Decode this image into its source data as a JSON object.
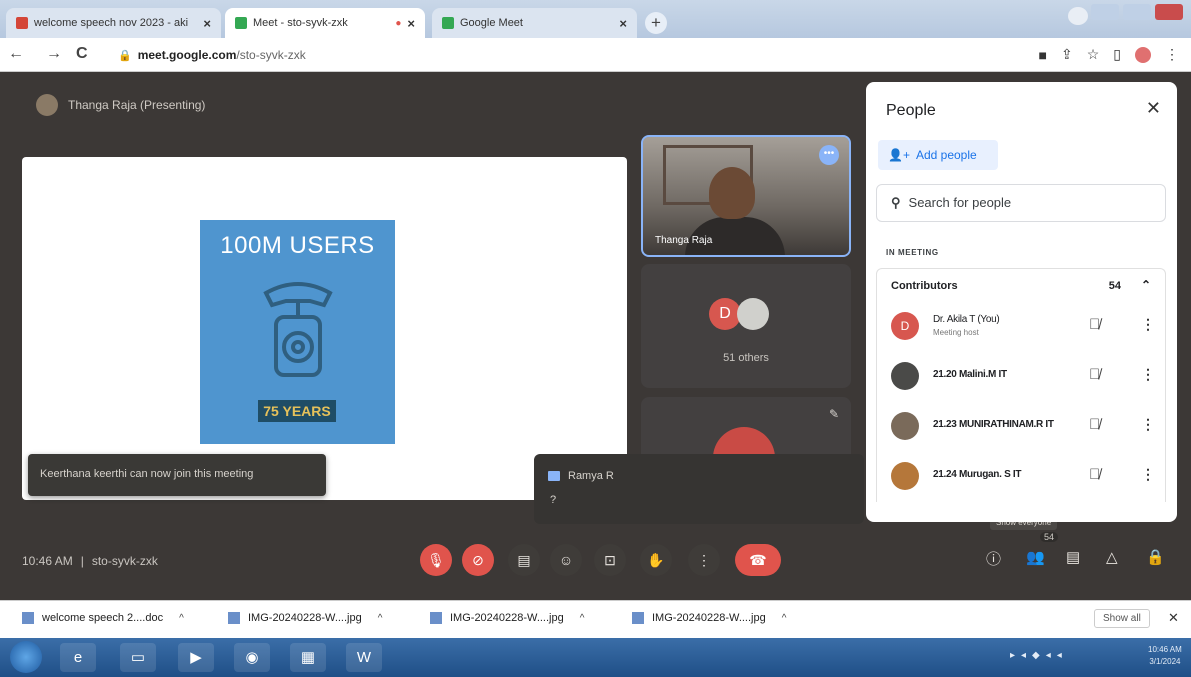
{
  "browser": {
    "tabs": [
      {
        "title": "welcome speech nov 2023 - aki",
        "icon": "gmail-icon",
        "active": false
      },
      {
        "title": "Meet - sto-syvk-zxk",
        "icon": "meet-icon",
        "active": true
      },
      {
        "title": "Google Meet",
        "icon": "meet-icon",
        "active": false
      }
    ],
    "url_host": "meet.google.com",
    "url_path": "/sto-syvk-zxk"
  },
  "meet": {
    "presenter": "Thanga Raja (Presenting)",
    "slide": {
      "title": "100M USERS",
      "badge": "75 YEARS"
    },
    "toast": "Keerthana keerthi can now join this meeting",
    "tiles": {
      "speaker_name": "Thanga Raja",
      "group_avatar_letter": "D",
      "others": "51 others"
    },
    "chat_popup": {
      "sender": "Ramya R",
      "message": "?"
    },
    "time": "10:46 AM",
    "meeting_code": "sto-syvk-zxk",
    "tooltip": "Show everyone",
    "people_count_badge": "54"
  },
  "people_panel": {
    "title": "People",
    "add_people": "Add people",
    "search_placeholder": "Search for people",
    "section": "IN MEETING",
    "contributors_label": "Contributors",
    "contributors_count": "54",
    "participants": [
      {
        "name": "Dr. Akila T (You)",
        "sub": "Meeting host",
        "avatar_color": "#d7574f",
        "initial": "D"
      },
      {
        "name": "21.20 Malini.M IT",
        "sub": "",
        "avatar_color": "#4a4a48",
        "initial": ""
      },
      {
        "name": "21.23 MUNIRATHINAM.R IT",
        "sub": "",
        "avatar_color": "#7a6a5a",
        "initial": ""
      },
      {
        "name": "21.24 Murugan. S IT",
        "sub": "",
        "avatar_color": "#b5773a",
        "initial": ""
      }
    ]
  },
  "downloads": {
    "items": [
      {
        "name": "welcome speech 2....doc"
      },
      {
        "name": "IMG-20240228-W....jpg"
      },
      {
        "name": "IMG-20240228-W....jpg"
      },
      {
        "name": "IMG-20240228-W....jpg"
      }
    ],
    "show_all": "Show all"
  },
  "taskbar": {
    "clock_time": "10:46 AM",
    "clock_date": "3/1/2024"
  },
  "colors": {
    "meet_bg": "#3c3836",
    "accent_blue": "#8ab4f8",
    "danger_red": "#e0544c",
    "poster_blue": "#4f95cf"
  }
}
